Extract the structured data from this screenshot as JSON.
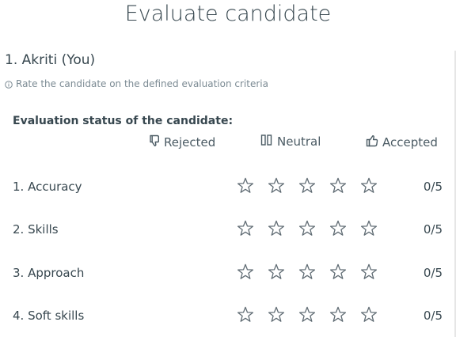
{
  "page": {
    "title": "Evaluate candidate"
  },
  "evaluator": {
    "name": "1. Akriti (You)",
    "hint": "Rate the candidate on the defined evaluation criteria"
  },
  "status": {
    "heading": "Evaluation status of the candidate:",
    "options": [
      {
        "label": "Rejected",
        "icon": "thumbs-down-icon"
      },
      {
        "label": "Neutral",
        "icon": "pause-icon"
      },
      {
        "label": "Accepted",
        "icon": "thumbs-up-icon"
      }
    ]
  },
  "criteria": [
    {
      "label": "1. Accuracy",
      "score": "0/5",
      "rating": 0,
      "max": 5
    },
    {
      "label": "2. Skills",
      "score": "0/5",
      "rating": 0,
      "max": 5
    },
    {
      "label": "3. Approach",
      "score": "0/5",
      "rating": 0,
      "max": 5
    },
    {
      "label": "4. Soft skills",
      "score": "0/5",
      "rating": 0,
      "max": 5
    }
  ],
  "colors": {
    "text": "#37474f",
    "muted": "#7b8a93",
    "star_outline": "#5f6b73"
  }
}
